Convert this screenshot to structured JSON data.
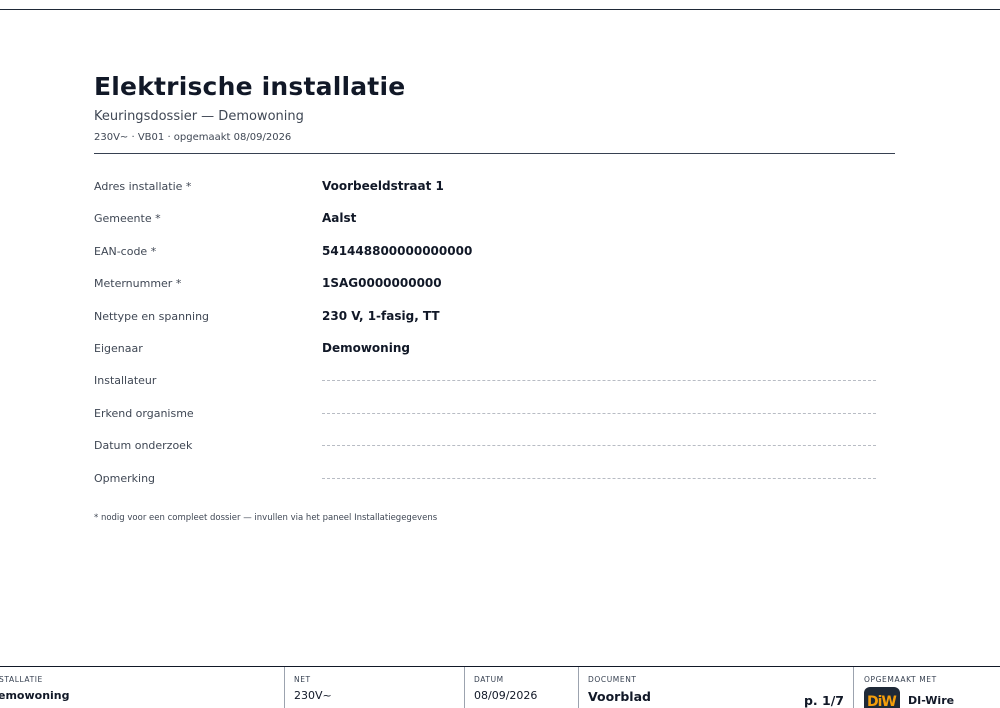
{
  "header": {
    "title": "Elektrische installatie",
    "subtitle": "Keuringsdossier — Demowoning",
    "meta": "230V~ · VB01 · opgemaakt 08/09/2026"
  },
  "fields": [
    {
      "label": "Adres installatie *",
      "value": "Voorbeeldstraat 1"
    },
    {
      "label": "Gemeente *",
      "value": "Aalst"
    },
    {
      "label": "EAN-code *",
      "value": "541448800000000000"
    },
    {
      "label": "Meternummer *",
      "value": "1SAG0000000000"
    },
    {
      "label": "Nettype en spanning",
      "value": "230 V, 1-fasig, TT"
    },
    {
      "label": "Eigenaar",
      "value": "Demowoning"
    },
    {
      "label": "Installateur",
      "value": ""
    },
    {
      "label": "Erkend organisme",
      "value": ""
    },
    {
      "label": "Datum onderzoek",
      "value": ""
    },
    {
      "label": "Opmerking",
      "value": ""
    }
  ],
  "footnote": "* nodig voor een compleet dossier — invullen via het paneel Installatiegegevens",
  "footer": {
    "installatie": {
      "caption": "STALLATIE",
      "value": "emowoning"
    },
    "net": {
      "caption": "NET",
      "value": "230V~"
    },
    "datum": {
      "caption": "DATUM",
      "value": "08/09/2026"
    },
    "document": {
      "caption": "DOCUMENT",
      "value": "Voorblad",
      "page": "p. 1/7"
    },
    "opgemaakt": {
      "caption": "OPGEMAAKT MET",
      "logo_icon": "di-wire-logo-icon",
      "brand": "DI-Wire"
    }
  },
  "colors": {
    "ink": "#111827",
    "muted": "#3f4754",
    "rule": "#374151",
    "dash": "#b8bcc4",
    "logo_bg": "#1f2937",
    "logo_accent": "#f59e0b"
  }
}
